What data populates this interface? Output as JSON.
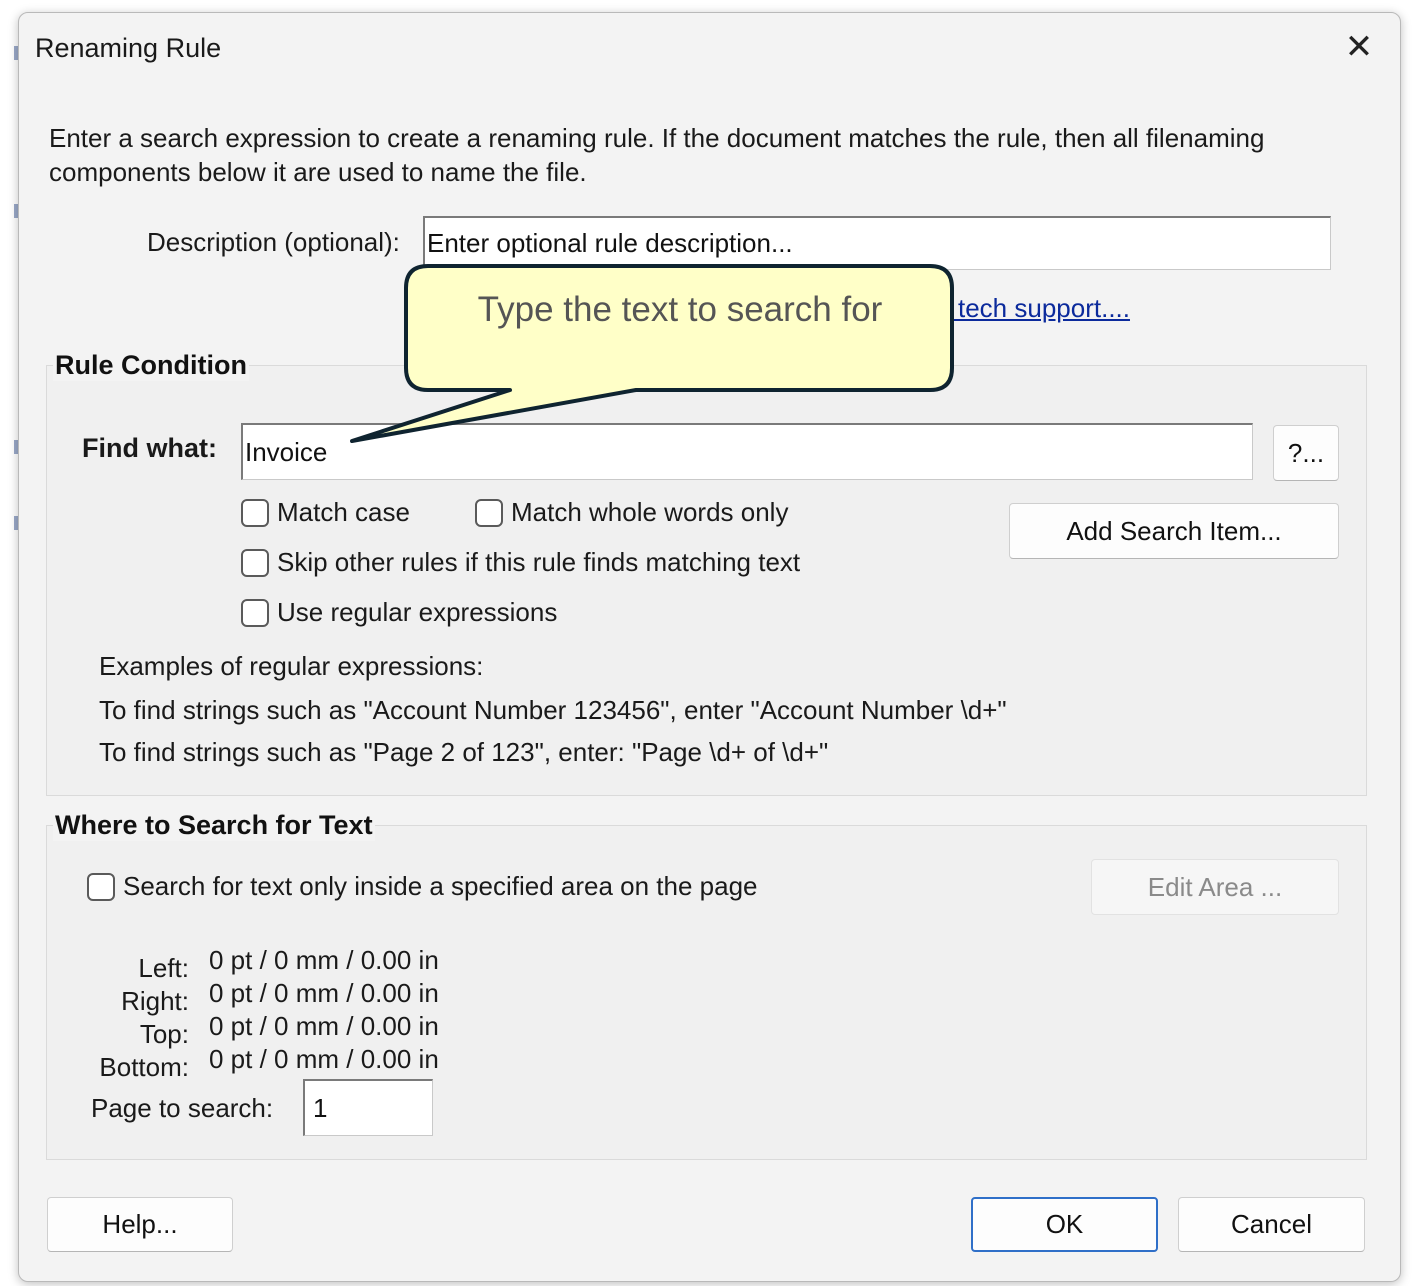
{
  "dialog": {
    "title": "Renaming Rule",
    "close_glyph": "✕",
    "intro": "Enter a search expression to create a renaming rule. If the document matches the rule, then all filenaming components below it are used to name the file."
  },
  "description": {
    "label": "Description (optional):",
    "value": "Enter optional rule description..."
  },
  "link": {
    "text": "l tech support...."
  },
  "callout": {
    "text": "Type the text to search for"
  },
  "rule_condition": {
    "title": "Rule Condition",
    "find_label": "Find what:",
    "find_value": "Invoice",
    "regex_help_button": "?...",
    "match_case": "Match case",
    "match_whole_words": "Match whole words only",
    "skip_other_rules": "Skip other rules if this rule finds matching text",
    "use_regex": "Use regular expressions",
    "add_search_item_button": "Add Search Item...",
    "examples_heading": "Examples of regular expressions:",
    "example_1": "To find strings such as \"Account Number 123456\", enter \"Account Number \\d+\"",
    "example_2": "To find strings such as \"Page 2 of 123\", enter: \"Page \\d+ of \\d+\""
  },
  "where_to_search": {
    "title": "Where to Search for Text",
    "area_only": "Search for text only inside a specified area on the page",
    "edit_area_button": "Edit Area ...",
    "left_label": "Left:",
    "left_value": "0 pt / 0 mm / 0.00 in",
    "right_label": "Right:",
    "right_value": "0 pt / 0 mm / 0.00 in",
    "top_label": "Top:",
    "top_value": "0 pt / 0 mm / 0.00 in",
    "bottom_label": "Bottom:",
    "bottom_value": "0 pt / 0 mm / 0.00 in",
    "page_label": "Page to search:",
    "page_value": "1"
  },
  "footer": {
    "help_button": "Help...",
    "ok_button": "OK",
    "cancel_button": "Cancel"
  }
}
